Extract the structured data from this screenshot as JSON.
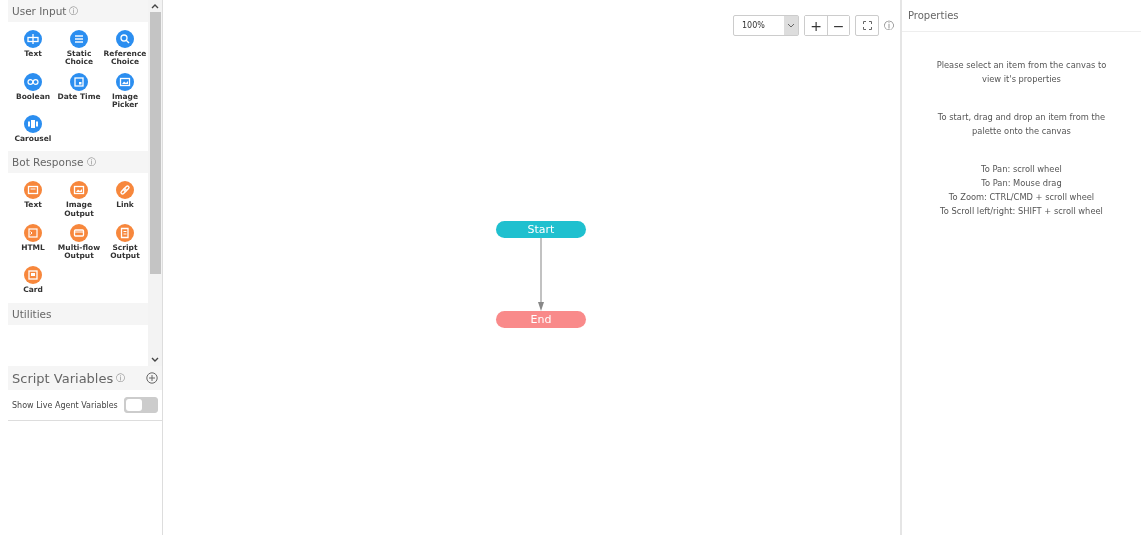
{
  "palette": {
    "sections": [
      {
        "title": "User Input",
        "info": "ⓘ",
        "color": "#2b8ef0",
        "items": [
          {
            "label": "Text"
          },
          {
            "label": "Static Choice"
          },
          {
            "label": "Reference Choice"
          },
          {
            "label": "Boolean"
          },
          {
            "label": "Date Time"
          },
          {
            "label": "Image Picker"
          },
          {
            "label": "Carousel"
          }
        ]
      },
      {
        "title": "Bot Response",
        "info": "ⓘ",
        "color": "#f7873c",
        "items": [
          {
            "label": "Text"
          },
          {
            "label": "Image Output"
          },
          {
            "label": "Link"
          },
          {
            "label": "HTML"
          },
          {
            "label": "Multi-flow Output"
          },
          {
            "label": "Script Output"
          },
          {
            "label": "Card"
          }
        ]
      },
      {
        "title": "Utilities"
      }
    ]
  },
  "script_variables": {
    "title": "Script Variables",
    "info": "ⓘ",
    "toggle": {
      "label": "Show Live Agent Variables",
      "on": false
    }
  },
  "toolbar": {
    "zoom": "100%",
    "plus": "+",
    "minus": "−",
    "info": "ⓘ"
  },
  "canvas": {
    "nodes": [
      {
        "label": "Start",
        "color": "#1fc0cf"
      },
      {
        "label": "End",
        "color": "#f98a8a"
      }
    ]
  },
  "properties": {
    "title": "Properties",
    "messages": [
      [
        "Please select an item from the canvas to view it's properties"
      ],
      [
        "To start, drag and drop an item from the palette onto the canvas"
      ],
      [
        "To Pan: scroll wheel",
        "To Pan: Mouse drag",
        "To Zoom: CTRL/CMD + scroll wheel",
        "To Scroll left/right: SHIFT + scroll wheel"
      ]
    ]
  }
}
